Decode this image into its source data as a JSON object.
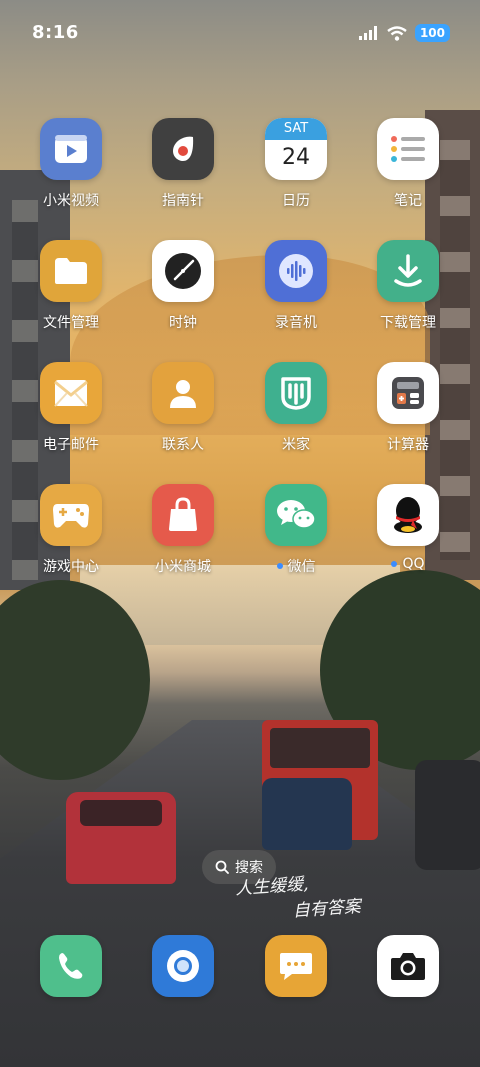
{
  "status_bar": {
    "time": "8:16",
    "battery": "100"
  },
  "apps": [
    {
      "label": "小米视频",
      "icon": "play-video-icon",
      "color": "#5a7fcf",
      "dot": false
    },
    {
      "label": "指南针",
      "icon": "compass-icon",
      "color": "#404040",
      "dot": false
    },
    {
      "label": "日历",
      "icon": "calendar-icon",
      "color": "#ffffff",
      "dot": false,
      "day": "SAT",
      "date": "24"
    },
    {
      "label": "笔记",
      "icon": "notes-icon",
      "color": "#ffffff",
      "dot": false
    },
    {
      "label": "文件管理",
      "icon": "folder-icon",
      "color": "#e0a53a",
      "dot": false
    },
    {
      "label": "时钟",
      "icon": "clock-icon",
      "color": "#ffffff",
      "dot": false
    },
    {
      "label": "录音机",
      "icon": "recorder-icon",
      "color": "#4f6fd6",
      "dot": false
    },
    {
      "label": "下载管理",
      "icon": "download-icon",
      "color": "#43b08a",
      "dot": false
    },
    {
      "label": "电子邮件",
      "icon": "mail-icon",
      "color": "#e8a63a",
      "dot": false
    },
    {
      "label": "联系人",
      "icon": "contact-icon",
      "color": "#e3a23d",
      "dot": false
    },
    {
      "label": "米家",
      "icon": "mijia-icon",
      "color": "#3fb08f",
      "dot": false
    },
    {
      "label": "计算器",
      "icon": "calculator-icon",
      "color": "#ffffff",
      "dot": false
    },
    {
      "label": "游戏中心",
      "icon": "gamepad-icon",
      "color": "#e6a944",
      "dot": false
    },
    {
      "label": "小米商城",
      "icon": "shopping-bag-icon",
      "color": "#e55a4b",
      "dot": false
    },
    {
      "label": "微信",
      "icon": "wechat-icon",
      "color": "#41b88a",
      "dot": true
    },
    {
      "label": "QQ",
      "icon": "qq-penguin-icon",
      "color": "#ffffff",
      "dot": true
    }
  ],
  "search": {
    "label": "搜索"
  },
  "dock": [
    {
      "name": "phone",
      "icon": "phone-icon",
      "color": "#4fbf8c"
    },
    {
      "name": "browser",
      "icon": "browser-icon",
      "color": "#2f7ad8"
    },
    {
      "name": "messages",
      "icon": "message-icon",
      "color": "#e7a536"
    },
    {
      "name": "camera",
      "icon": "camera-icon",
      "color": "#ffffff"
    }
  ],
  "wallpaper_text": {
    "line1": "人生缓缓,",
    "line2": "自有答案"
  }
}
